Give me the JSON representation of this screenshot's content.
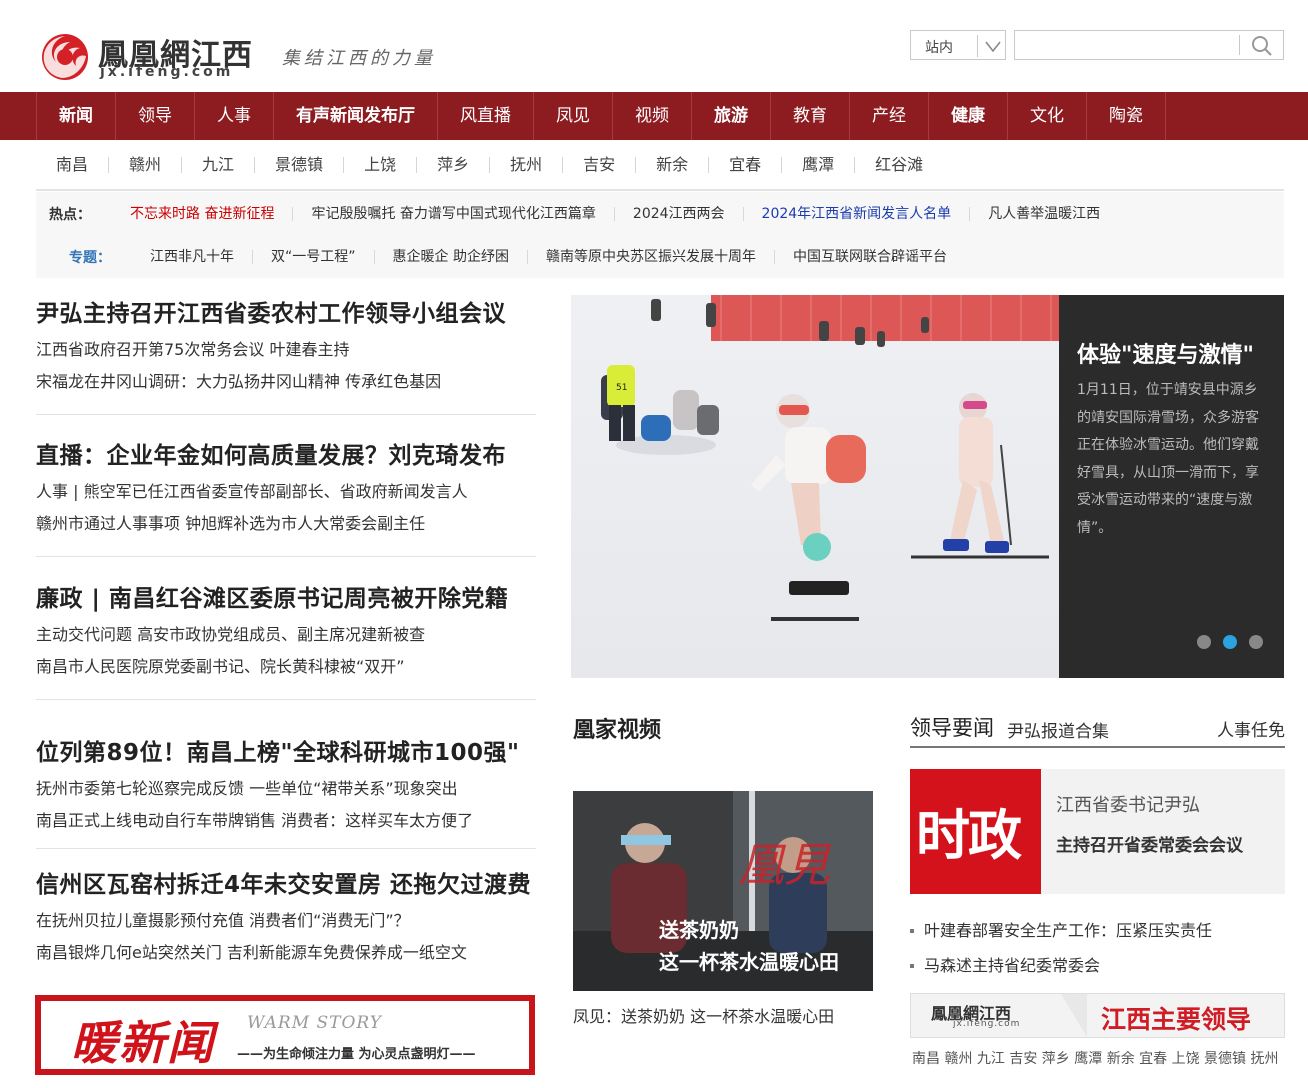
{
  "header": {
    "logo_name": "凰網江西",
    "logo_name_prefix": "鳳",
    "logo_domain": "jx.ifeng.com",
    "logo_slogan": "集结江西的力量",
    "search_scope": "站内",
    "search_placeholder": "",
    "brand_color": "#8d1c21"
  },
  "main_nav": [
    {
      "label": "新闻",
      "bold": true
    },
    {
      "label": "领导",
      "bold": false
    },
    {
      "label": "人事",
      "bold": false
    },
    {
      "label": "有声新闻发布厅",
      "bold": true
    },
    {
      "label": "风直播",
      "bold": false
    },
    {
      "label": "凤见",
      "bold": false
    },
    {
      "label": "视频",
      "bold": false
    },
    {
      "label": "旅游",
      "bold": true
    },
    {
      "label": "教育",
      "bold": false
    },
    {
      "label": "产经",
      "bold": false
    },
    {
      "label": "健康",
      "bold": true
    },
    {
      "label": "文化",
      "bold": false
    },
    {
      "label": "陶瓷",
      "bold": false
    }
  ],
  "city_nav": [
    "南昌",
    "赣州",
    "九江",
    "景德镇",
    "上饶",
    "萍乡",
    "抚州",
    "吉安",
    "新余",
    "宜春",
    "鹰潭",
    "红谷滩"
  ],
  "hot": {
    "label": "热点：",
    "items": [
      "不忘来时路 奋进新征程",
      "牢记殷殷嘱托 奋力谱写中国式现代化江西篇章",
      "2024江西两会",
      "2024年江西省新闻发言人名单",
      "凡人善举温暖江西"
    ]
  },
  "topics": {
    "label": "专题：",
    "items": [
      "江西非凡十年",
      "双“一号工程”",
      "惠企暖企 助企纾困",
      "赣南等原中央苏区振兴发展十周年",
      "中国互联网联合辟谣平台"
    ]
  },
  "headlines": [
    {
      "title": "尹弘主持召开江西省委农村工作领导小组会议",
      "lines": [
        "江西省政府召开第75次常务会议 叶建春主持",
        "宋福龙在井冈山调研：大力弘扬井冈山精神 传承红色基因"
      ]
    },
    {
      "title": "直播：企业年金如何高质量发展？刘克琦发布",
      "lines": [
        "人事 | 熊空军已任江西省委宣传部副部长、省政府新闻发言人",
        "赣州市通过人事事项 钟旭辉补选为市人大常委会副主任"
      ]
    },
    {
      "title": "廉政 | 南昌红谷滩区委原书记周亮被开除党籍",
      "lines": [
        "主动交代问题 高安市政协党组成员、副主席况建新被查",
        "南昌市人民医院原党委副书记、院长黄科棣被“双开”"
      ]
    },
    {
      "title": "位列第89位！南昌上榜\"全球科研城市100强\"",
      "lines": [
        "抚州市委第七轮巡察完成反馈 一些单位“裙带关系”现象突出",
        "南昌正式上线电动自行车带牌销售 消费者：这样买车太方便了"
      ]
    },
    {
      "title": "信州区瓦窑村拆迁4年未交安置房 还拖欠过渡费",
      "lines": [
        "在抚州贝拉儿童摄影预付充值 消费者们“消费无门”？",
        "南昌银烨几何e站突然关门 吉利新能源车免费保养成一纸空文"
      ]
    }
  ],
  "warm_banner": {
    "big": "暖新闻",
    "en": "WARM STORY",
    "sub": "——为生命倾注力量 为心灵点盏明灯——"
  },
  "slideshow": {
    "title": "体验\"速度与激情\"",
    "desc": "1月11日，位于靖安县中源乡的靖安国际滑雪场，众多游客正在体验冰雪运动。他们穿戴好雪具，从山顶一滑而下，享受冰雪运动带来的“速度与激情”。",
    "bib": "51",
    "dots": 3,
    "active_dot": 1
  },
  "video": {
    "section_title": "凰家视频",
    "overlay_line1": "送茶奶奶",
    "overlay_line2": "这一杯茶水温暖心田",
    "caption": "凤见：送茶奶奶 这一杯茶水温暖心田",
    "watermark": "凰見"
  },
  "leaders": {
    "title": "领导要闻",
    "sub_link": "尹弘报道合集",
    "right_link": "人事任免",
    "feature_tag": "时政",
    "feature_line1": "江西省委书记尹弘",
    "feature_line2": "主持召开省委常委会会议",
    "list": [
      "叶建春部署安全生产工作：压紧压实责任",
      "马森述主持省纪委常委会"
    ],
    "banner_logo": "鳳凰網江西",
    "banner_domain": "jx.ifeng.com",
    "banner_text": "江西主要领导",
    "cities": "南昌 赣州 九江 吉安 萍乡 鹰潭 新余 宜春 上饶 景德镇 抚州"
  }
}
